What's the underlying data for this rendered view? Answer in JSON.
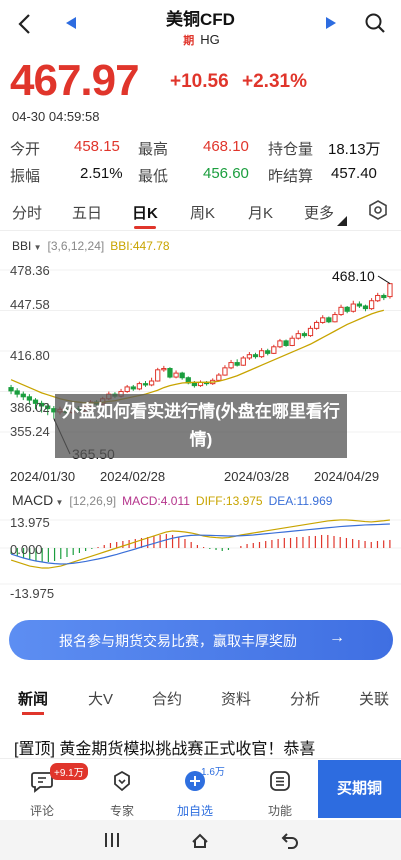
{
  "header": {
    "title": "美铜CFD",
    "tag": "期",
    "code": "HG"
  },
  "quote": {
    "price": "467.97",
    "change": "+10.56",
    "change_pct": "+2.31%",
    "time": "04-30 04:59:58",
    "rows": [
      [
        {
          "label": "今开",
          "value": "458.15",
          "color": "red"
        },
        {
          "label": "最高",
          "value": "468.10",
          "color": "red"
        },
        {
          "label": "持仓量",
          "value": "18.13万",
          "color": "dark"
        }
      ],
      [
        {
          "label": "振幅",
          "value": "2.51%",
          "color": "dark"
        },
        {
          "label": "最低",
          "value": "456.60",
          "color": "green"
        },
        {
          "label": "昨结算",
          "value": "457.40",
          "color": "dark"
        }
      ]
    ]
  },
  "period_tabs": [
    "分时",
    "五日",
    "日K",
    "周K",
    "月K",
    "更多"
  ],
  "boll": {
    "name": "BBI",
    "params": "[3,6,12,24]",
    "value": "BBI:447.78"
  },
  "macd": {
    "name": "MACD",
    "params": "[12,26,9]",
    "macd": "MACD:4.011",
    "diff": "DIFF:13.975",
    "dea": "DEA:11.969"
  },
  "chart_data": {
    "type": "candlestick",
    "y_ticks": [
      "478.36",
      "447.58",
      "416.80",
      "386.02",
      "355.24"
    ],
    "x_ticks": [
      "2024/01/30",
      "2024/02/28",
      "2024/03/28",
      "2024/04/29"
    ],
    "ylim": [
      355.24,
      478.36
    ],
    "high_marker": "468.10",
    "low_marker": "365.50",
    "macd_ticks": [
      "13.975",
      "0.000",
      "-13.975"
    ],
    "macd_ylim": [
      -13.975,
      13.975
    ],
    "candles": [
      {
        "o": 389.0,
        "c": 386.5,
        "h": 391.0,
        "l": 384.0
      },
      {
        "o": 386.5,
        "c": 384.0,
        "h": 388.5,
        "l": 381.5
      },
      {
        "o": 384.0,
        "c": 382.0,
        "h": 386.0,
        "l": 379.5
      },
      {
        "o": 382.0,
        "c": 379.5,
        "h": 384.0,
        "l": 376.0
      },
      {
        "o": 379.5,
        "c": 377.0,
        "h": 381.0,
        "l": 372.5
      },
      {
        "o": 377.0,
        "c": 375.0,
        "h": 379.0,
        "l": 370.0
      },
      {
        "o": 375.0,
        "c": 373.0,
        "h": 377.0,
        "l": 368.0
      },
      {
        "o": 373.0,
        "c": 370.5,
        "h": 375.0,
        "l": 365.5
      },
      {
        "o": 370.5,
        "c": 372.5,
        "h": 374.5,
        "l": 368.5
      },
      {
        "o": 372.5,
        "c": 370.0,
        "h": 374.0,
        "l": 368.0
      },
      {
        "o": 370.0,
        "c": 373.0,
        "h": 375.0,
        "l": 369.0
      },
      {
        "o": 373.0,
        "c": 371.5,
        "h": 375.0,
        "l": 370.0
      },
      {
        "o": 371.5,
        "c": 374.5,
        "h": 376.5,
        "l": 370.5
      },
      {
        "o": 374.5,
        "c": 378.0,
        "h": 379.5,
        "l": 373.5
      },
      {
        "o": 378.0,
        "c": 376.5,
        "h": 379.5,
        "l": 375.0
      },
      {
        "o": 376.5,
        "c": 380.5,
        "h": 382.0,
        "l": 375.5
      },
      {
        "o": 380.5,
        "c": 384.0,
        "h": 386.0,
        "l": 379.5
      },
      {
        "o": 384.0,
        "c": 382.5,
        "h": 385.5,
        "l": 381.0
      },
      {
        "o": 382.5,
        "c": 386.0,
        "h": 388.0,
        "l": 381.5
      },
      {
        "o": 386.0,
        "c": 389.5,
        "h": 391.0,
        "l": 385.0
      },
      {
        "o": 389.5,
        "c": 388.0,
        "h": 391.0,
        "l": 386.5
      },
      {
        "o": 388.0,
        "c": 392.0,
        "h": 393.5,
        "l": 387.0
      },
      {
        "o": 392.0,
        "c": 391.0,
        "h": 394.0,
        "l": 389.5
      },
      {
        "o": 391.0,
        "c": 394.0,
        "h": 396.5,
        "l": 390.0
      },
      {
        "o": 394.0,
        "c": 402.5,
        "h": 404.0,
        "l": 393.5
      },
      {
        "o": 402.5,
        "c": 403.5,
        "h": 405.5,
        "l": 401.0
      },
      {
        "o": 403.5,
        "c": 397.0,
        "h": 404.5,
        "l": 396.0
      },
      {
        "o": 397.0,
        "c": 400.0,
        "h": 402.0,
        "l": 396.0
      },
      {
        "o": 400.0,
        "c": 396.5,
        "h": 401.0,
        "l": 395.0
      },
      {
        "o": 396.5,
        "c": 392.5,
        "h": 397.5,
        "l": 391.5
      },
      {
        "o": 392.5,
        "c": 390.5,
        "h": 394.0,
        "l": 389.0
      },
      {
        "o": 390.5,
        "c": 393.0,
        "h": 394.5,
        "l": 389.5
      },
      {
        "o": 393.0,
        "c": 392.0,
        "h": 394.0,
        "l": 390.5
      },
      {
        "o": 392.0,
        "c": 394.5,
        "h": 396.0,
        "l": 391.0
      },
      {
        "o": 394.5,
        "c": 398.5,
        "h": 400.0,
        "l": 394.0
      },
      {
        "o": 398.5,
        "c": 404.0,
        "h": 406.0,
        "l": 398.0
      },
      {
        "o": 404.0,
        "c": 408.0,
        "h": 410.0,
        "l": 403.0
      },
      {
        "o": 408.0,
        "c": 406.0,
        "h": 410.5,
        "l": 405.0
      },
      {
        "o": 406.0,
        "c": 411.5,
        "h": 413.0,
        "l": 405.5
      },
      {
        "o": 411.5,
        "c": 414.0,
        "h": 416.0,
        "l": 410.0
      },
      {
        "o": 414.0,
        "c": 412.5,
        "h": 415.5,
        "l": 411.0
      },
      {
        "o": 412.5,
        "c": 417.0,
        "h": 419.0,
        "l": 411.5
      },
      {
        "o": 417.0,
        "c": 415.0,
        "h": 418.5,
        "l": 413.5
      },
      {
        "o": 415.0,
        "c": 420.0,
        "h": 421.5,
        "l": 414.5
      },
      {
        "o": 420.0,
        "c": 424.5,
        "h": 426.0,
        "l": 419.0
      },
      {
        "o": 424.5,
        "c": 421.0,
        "h": 425.5,
        "l": 420.0
      },
      {
        "o": 421.0,
        "c": 426.5,
        "h": 428.5,
        "l": 420.5
      },
      {
        "o": 426.5,
        "c": 430.0,
        "h": 432.5,
        "l": 425.5
      },
      {
        "o": 430.0,
        "c": 428.5,
        "h": 431.5,
        "l": 427.0
      },
      {
        "o": 428.5,
        "c": 434.0,
        "h": 436.0,
        "l": 427.5
      },
      {
        "o": 434.0,
        "c": 438.5,
        "h": 440.0,
        "l": 433.0
      },
      {
        "o": 438.5,
        "c": 442.0,
        "h": 444.0,
        "l": 437.5
      },
      {
        "o": 442.0,
        "c": 439.0,
        "h": 443.0,
        "l": 438.0
      },
      {
        "o": 439.0,
        "c": 444.5,
        "h": 446.5,
        "l": 438.5
      },
      {
        "o": 444.5,
        "c": 450.0,
        "h": 452.0,
        "l": 443.5
      },
      {
        "o": 450.0,
        "c": 447.0,
        "h": 451.0,
        "l": 445.5
      },
      {
        "o": 447.0,
        "c": 452.5,
        "h": 455.0,
        "l": 446.0
      },
      {
        "o": 452.5,
        "c": 451.0,
        "h": 454.5,
        "l": 449.5
      },
      {
        "o": 451.0,
        "c": 449.0,
        "h": 452.0,
        "l": 447.0
      },
      {
        "o": 449.0,
        "c": 455.0,
        "h": 457.0,
        "l": 448.0
      },
      {
        "o": 455.0,
        "c": 459.0,
        "h": 461.0,
        "l": 454.0
      },
      {
        "o": 459.0,
        "c": 457.4,
        "h": 460.5,
        "l": 455.5
      },
      {
        "o": 458.15,
        "c": 467.97,
        "h": 468.1,
        "l": 456.6
      }
    ],
    "bbi": [
      395.0,
      393.0,
      391.0,
      389.0,
      387.0,
      385.0,
      383.5,
      382.0,
      380.5,
      379.5,
      378.5,
      378.0,
      377.5,
      377.5,
      377.5,
      377.8,
      378.5,
      379.0,
      380.0,
      381.0,
      382.0,
      383.0,
      384.0,
      385.5,
      387.0,
      389.0,
      390.5,
      391.5,
      392.5,
      392.8,
      393.0,
      393.0,
      393.0,
      393.2,
      393.8,
      395.0,
      396.5,
      398.0,
      400.0,
      402.0,
      404.0,
      406.0,
      408.0,
      410.0,
      412.0,
      414.0,
      416.0,
      418.0,
      420.0,
      422.0,
      424.5,
      427.0,
      429.5,
      432.0,
      434.5,
      437.0,
      439.0,
      441.0,
      443.0,
      445.0,
      446.5,
      447.78
    ],
    "macd_hist": [
      -3,
      -4,
      -5,
      -6,
      -6.5,
      -7,
      -7,
      -6.5,
      -5.5,
      -4.5,
      -3.5,
      -2.5,
      -1.5,
      -0.5,
      0.5,
      1.5,
      2.5,
      3,
      3.5,
      4,
      4.5,
      5,
      5.5,
      6,
      6.5,
      7,
      6.5,
      5.5,
      4.5,
      3,
      1.5,
      0.5,
      -0.5,
      -1,
      -1.5,
      -1,
      0,
      1,
      2,
      2.5,
      3,
      3.5,
      4,
      4.5,
      5,
      5,
      5.5,
      5.5,
      6,
      6,
      6.5,
      6.5,
      6,
      5.5,
      5,
      4.5,
      4,
      3.5,
      3,
      3.5,
      3.8,
      4.011
    ],
    "diff": [
      -6,
      -7,
      -8,
      -9,
      -9.5,
      -10,
      -10,
      -9.5,
      -9,
      -8,
      -7,
      -6,
      -5,
      -4,
      -3,
      -2,
      -1,
      0,
      1,
      2,
      3,
      4,
      5,
      6,
      7,
      8,
      8.5,
      8.3,
      8,
      7.5,
      6.8,
      6,
      5.5,
      5.2,
      5,
      5.2,
      5.8,
      6.5,
      7,
      7.5,
      8,
      8.5,
      9,
      9.5,
      10,
      10.5,
      11,
      11.5,
      12,
      12.5,
      13,
      13.5,
      13.8,
      14,
      14,
      13.8,
      13.5,
      13.2,
      13,
      13.3,
      13.6,
      13.975
    ],
    "dea": [
      -3,
      -4,
      -5,
      -5.8,
      -6.5,
      -7,
      -7.5,
      -7.8,
      -8,
      -7.9,
      -7.6,
      -7.2,
      -6.7,
      -6.1,
      -5.5,
      -4.8,
      -4,
      -3.2,
      -2.3,
      -1.4,
      -0.5,
      0.5,
      1.4,
      2.3,
      3.2,
      4.1,
      4.9,
      5.5,
      6,
      6.3,
      6.4,
      6.4,
      6.3,
      6.2,
      6.1,
      6,
      6,
      6.1,
      6.3,
      6.5,
      6.8,
      7.1,
      7.4,
      7.7,
      8,
      8.3,
      8.6,
      8.9,
      9.2,
      9.5,
      9.8,
      10.1,
      10.4,
      10.7,
      10.9,
      11.1,
      11.3,
      11.5,
      11.6,
      11.7,
      11.85,
      11.969
    ]
  },
  "overlay_text": "外盘如何看实进行情(外盘在哪里看行情)",
  "banner": {
    "text": "报名参与期货交易比赛，赢取丰厚奖励",
    "arrow": "→"
  },
  "news_tabs": [
    "新闻",
    "大V",
    "合约",
    "资料",
    "分析",
    "关联"
  ],
  "news_headline": "[置顶] 黄金期货模拟挑战赛正式收官！恭喜",
  "bottom": {
    "comment_label": "评论",
    "comment_badge": "+9.1万",
    "expert_label": "专家",
    "watch_label": "加自选",
    "watch_count": "1.6万",
    "func_label": "功能",
    "buy_label": "买期铜"
  },
  "colors": {
    "up": "#e0352b",
    "down": "#1b9e3e",
    "bbi": "#c8a400",
    "diff": "#c8a400",
    "dea": "#3a6fd8",
    "accent": "#2d6ce0"
  }
}
